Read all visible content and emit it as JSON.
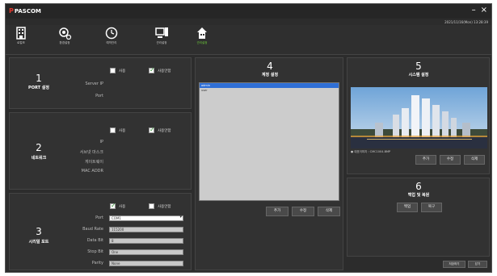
{
  "app": {
    "logo_text": "PASCOM",
    "datetime": "2021/11/16(Mon) 13:28:39"
  },
  "window_controls": {
    "minimize": "–",
    "close": "×"
  },
  "toolbar": [
    {
      "label": "로컬조",
      "icon": "building-icon"
    },
    {
      "label": "환경설정",
      "icon": "gear-network-icon"
    },
    {
      "label": "예약관리",
      "icon": "clock-icon"
    },
    {
      "label": "관리설정",
      "icon": "monitor-icon"
    },
    {
      "label": "관리설정",
      "icon": "house-icon",
      "active": true
    }
  ],
  "port_panel": {
    "number": "1",
    "title": "PORT 설정",
    "cb_use": "사용",
    "cb_unused": "사용안함",
    "labels": [
      "Server IP",
      "Port"
    ]
  },
  "network_panel": {
    "number": "2",
    "title": "네트워크",
    "cb_use": "사용",
    "cb_unused": "사용안함",
    "labels": [
      "IP",
      "서브넷 마스크",
      "게이트웨이",
      "MAC ADDR"
    ]
  },
  "serial_panel": {
    "number": "3",
    "title": "시리얼 포트",
    "cb_use": "사용",
    "cb_unused": "사용안함",
    "labels": [
      "Port",
      "Baud Rate",
      "Data Bit",
      "Stop Bit",
      "Parity"
    ],
    "values": [
      "COM1",
      "115200",
      "8",
      "One",
      "None"
    ]
  },
  "account_panel": {
    "number": "4",
    "title": "계정 설정",
    "list": [
      "admin",
      "user"
    ],
    "btn_add": "추가",
    "btn_edit": "수정",
    "btn_delete": "삭제"
  },
  "system_panel": {
    "number": "5",
    "title": "시스템 설정",
    "caption": "● 대표이미지 : CMC1004.BMP",
    "btn_add": "추가",
    "btn_edit": "수정",
    "btn_delete": "삭제"
  },
  "backup_panel": {
    "number": "6",
    "title": "백업 및 복원",
    "btn_backup": "백업",
    "btn_restore": "복구"
  },
  "footer": {
    "btn_apply": "저장하기",
    "btn_close": "닫기"
  }
}
